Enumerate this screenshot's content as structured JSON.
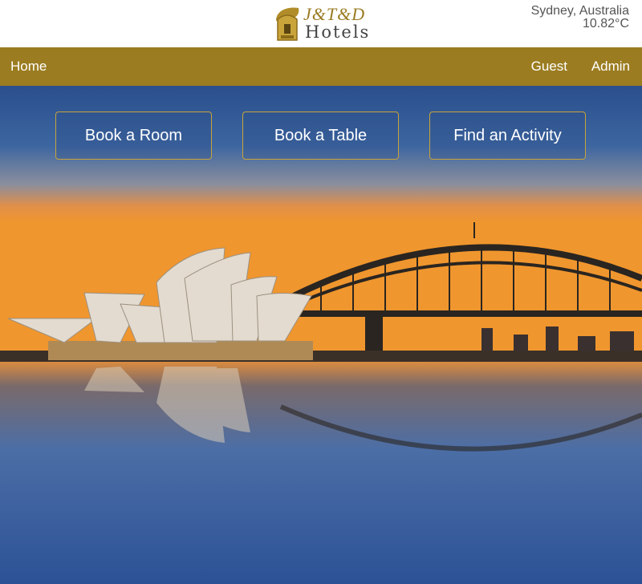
{
  "brand": {
    "name_line1": "J&T&D",
    "name_line2": "Hotels",
    "logo_icon": "hotel-leaf-logo",
    "gold": "#9b7c21"
  },
  "location": {
    "city": "Sydney, Australia",
    "temperature": "10.82°C"
  },
  "nav": {
    "home": "Home",
    "guest": "Guest",
    "admin": "Admin"
  },
  "actions": {
    "book_room": "Book a Room",
    "book_table": "Book a Table",
    "find_activity": "Find an Activity"
  },
  "hero": {
    "image": "sydney-opera-house-harbour-bridge-sunset"
  }
}
